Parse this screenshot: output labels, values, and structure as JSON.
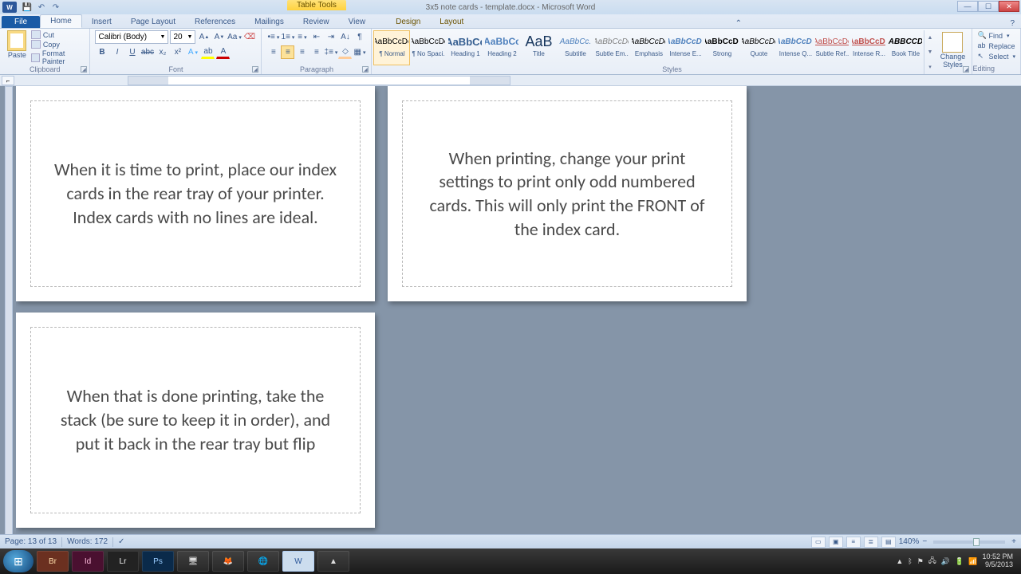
{
  "title": {
    "document": "3x5 note cards - template.docx - Microsoft Word",
    "contextual_tab": "Table Tools"
  },
  "ribbon_tabs": {
    "file": "File",
    "home": "Home",
    "insert": "Insert",
    "page_layout": "Page Layout",
    "references": "References",
    "mailings": "Mailings",
    "review": "Review",
    "view": "View",
    "design": "Design",
    "layout": "Layout"
  },
  "clipboard": {
    "paste": "Paste",
    "cut": "Cut",
    "copy": "Copy",
    "format_painter": "Format Painter",
    "label": "Clipboard"
  },
  "font": {
    "name": "Calibri (Body)",
    "size": "20",
    "bold": "B",
    "italic": "I",
    "underline": "U",
    "strike": "abc",
    "sub": "x₂",
    "sup": "x²",
    "grow": "A",
    "shrink": "A",
    "case": "Aa",
    "clear": "⌫",
    "label": "Font"
  },
  "paragraph": {
    "label": "Paragraph"
  },
  "styles": {
    "label": "Styles",
    "items": [
      {
        "prev": "AaBbCcDc",
        "name": "¶ Normal",
        "color": "#000"
      },
      {
        "prev": "AaBbCcDc",
        "name": "¶ No Spaci...",
        "color": "#000"
      },
      {
        "prev": "AaBbCc",
        "name": "Heading 1",
        "color": "#365f91",
        "bold": true,
        "size": "13px"
      },
      {
        "prev": "AaBbCc",
        "name": "Heading 2",
        "color": "#4f81bd",
        "bold": true,
        "size": "12px"
      },
      {
        "prev": "AaB",
        "name": "Title",
        "color": "#17365d",
        "size": "18px"
      },
      {
        "prev": "AaBbCc.",
        "name": "Subtitle",
        "color": "#4f81bd",
        "ital": true
      },
      {
        "prev": "AaBbCcDc",
        "name": "Subtle Em...",
        "color": "#808080",
        "ital": true
      },
      {
        "prev": "AaBbCcDc",
        "name": "Emphasis",
        "color": "#000",
        "ital": true
      },
      {
        "prev": "AaBbCcDc",
        "name": "Intense E...",
        "color": "#4f81bd",
        "ital": true,
        "bold": true
      },
      {
        "prev": "AaBbCcDc",
        "name": "Strong",
        "color": "#000",
        "bold": true
      },
      {
        "prev": "AaBbCcDc",
        "name": "Quote",
        "color": "#000",
        "ital": true
      },
      {
        "prev": "AaBbCcDc",
        "name": "Intense Q...",
        "color": "#4f81bd",
        "ital": true,
        "bold": true
      },
      {
        "prev": "AaBbCcDc",
        "name": "Subtle Ref...",
        "color": "#c0504d",
        "under": true
      },
      {
        "prev": "AaBbCcDc",
        "name": "Intense R...",
        "color": "#c0504d",
        "under": true,
        "bold": true
      },
      {
        "prev": "AABBCCDC",
        "name": "Book Title",
        "color": "#000",
        "bold": true,
        "ital": true
      }
    ],
    "change": "Change Styles"
  },
  "editing": {
    "find": "Find",
    "replace": "Replace",
    "select": "Select",
    "label": "Editing"
  },
  "cards": {
    "c1": "When it is time to print, place our index cards in the rear tray of your printer.  Index cards with no lines are ideal.",
    "c2": "When printing, change your print settings to print only odd numbered cards.  This will only print the FRONT of the index card.",
    "c3": "When that is done printing, take the stack (be sure to keep it in order), and put it back in the rear tray but flip"
  },
  "status": {
    "page": "Page: 13 of 13",
    "words": "Words: 172",
    "zoom": "140%"
  },
  "tray": {
    "time": "10:52 PM",
    "date": "9/5/2013"
  }
}
